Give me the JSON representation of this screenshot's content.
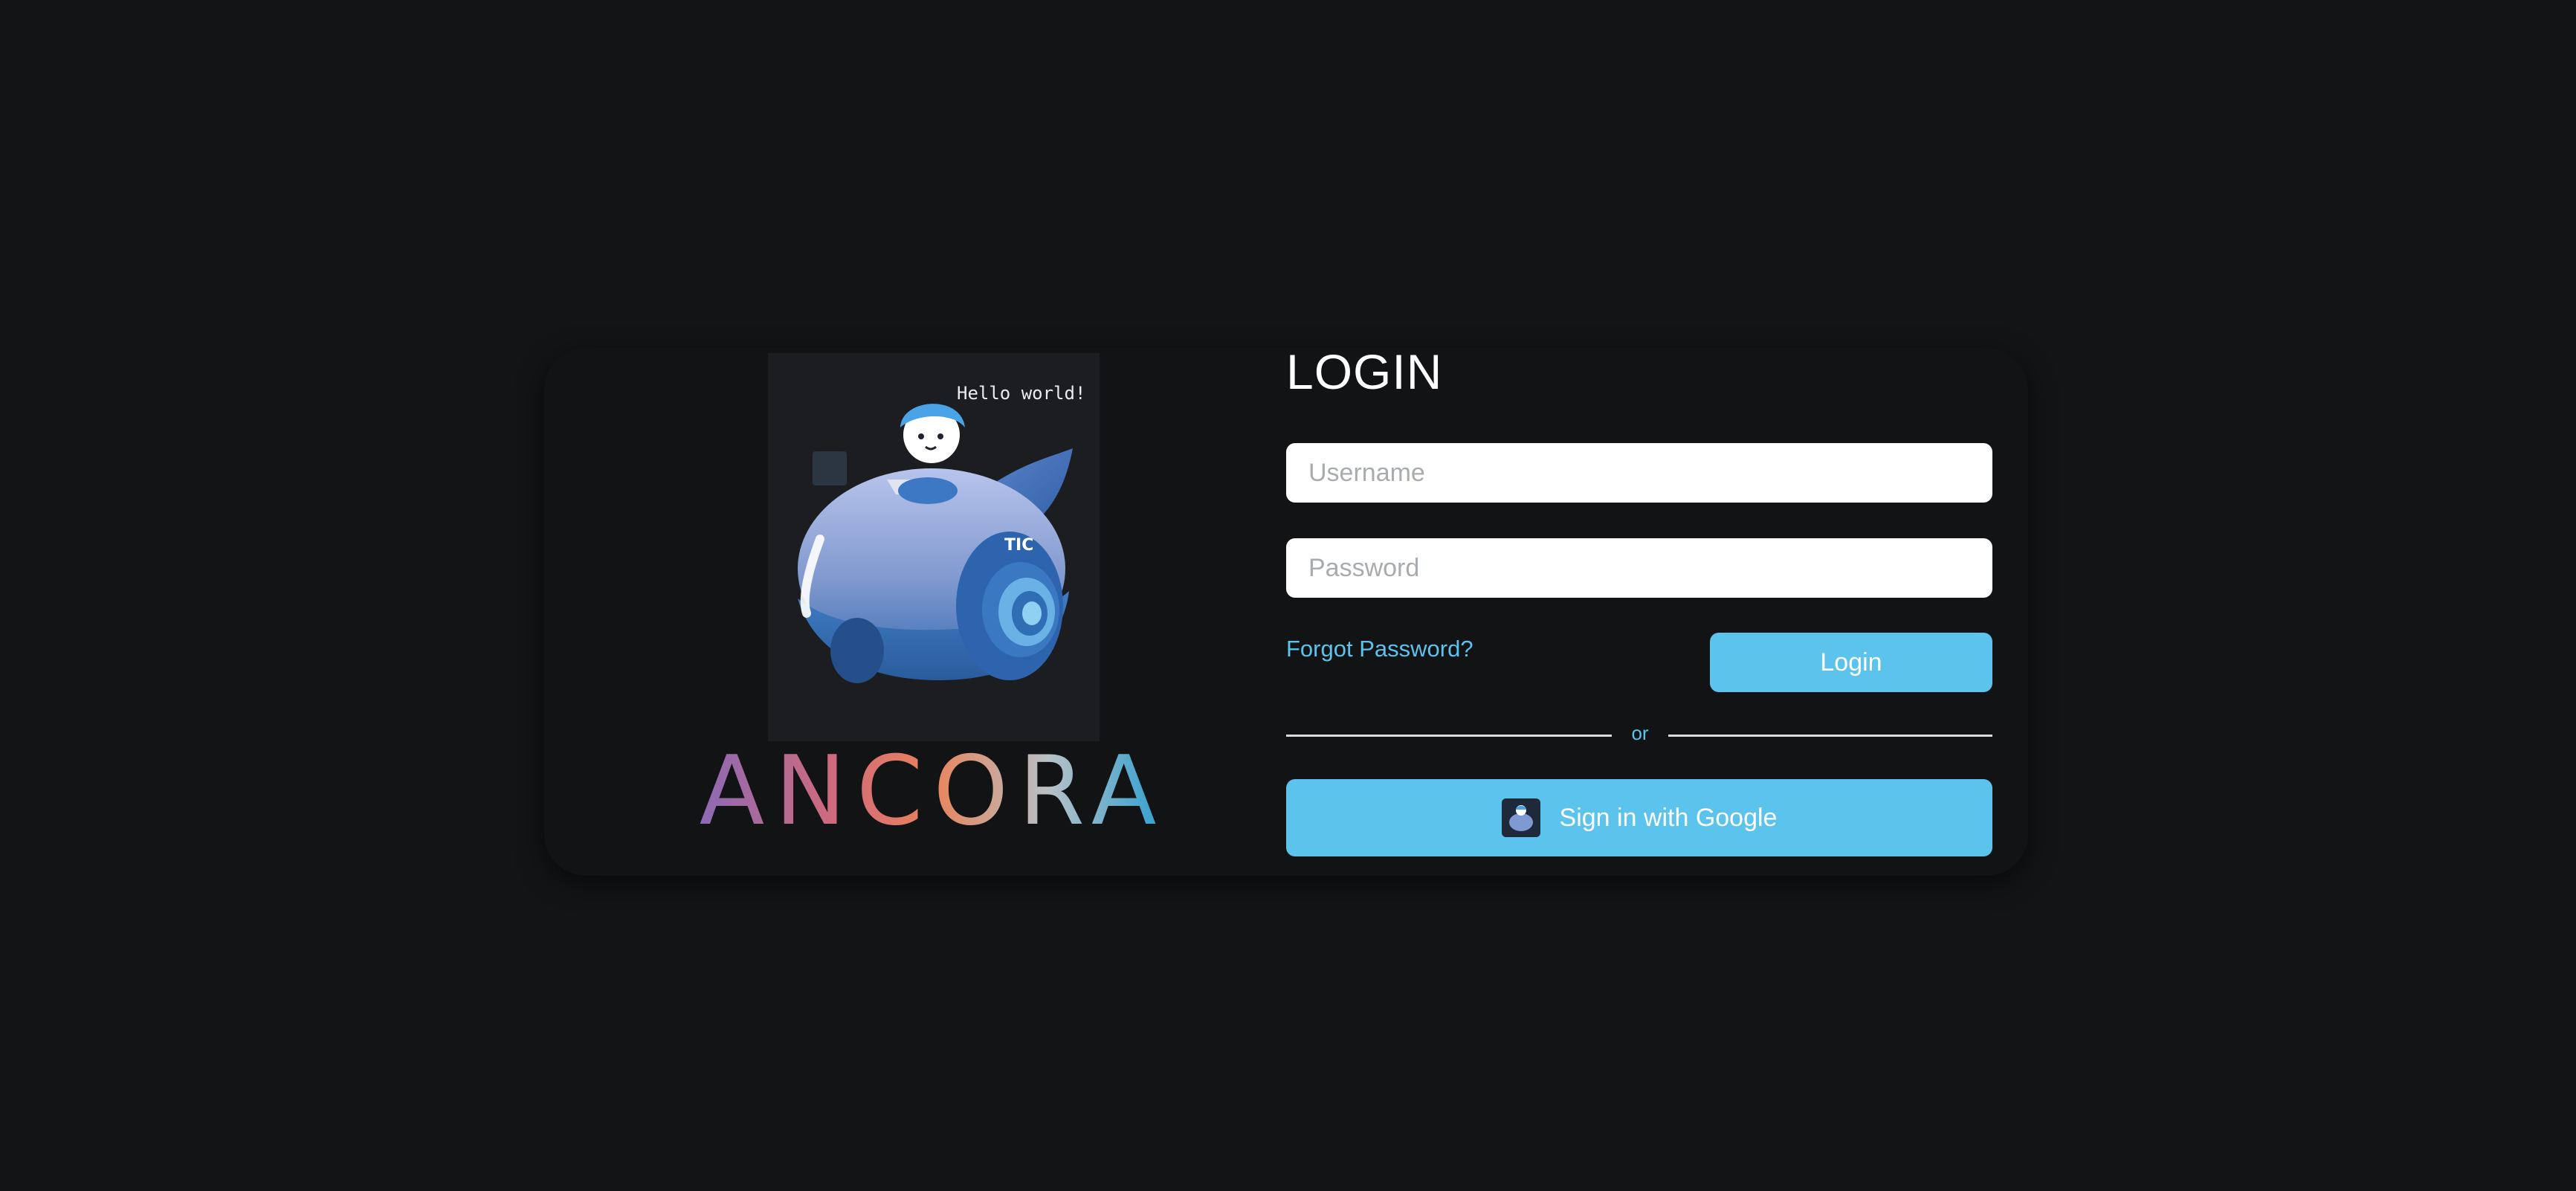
{
  "illustration": {
    "speech_text": "Hello world!",
    "icon": "robot-whale-mascot"
  },
  "brand": {
    "name": "ANCORA",
    "gradient": [
      "#8c69b5",
      "#d36a7a",
      "#e8845b",
      "#b6c1c7",
      "#2c9fd1"
    ]
  },
  "login": {
    "title": "LOGIN",
    "username_placeholder": "Username",
    "password_placeholder": "Password",
    "forgot_label": "Forgot Password?",
    "login_label": "Login",
    "divider_text": "or",
    "google_label": "Sign in with Google"
  },
  "colors": {
    "background": "#131416",
    "accent": "#5bc3ec",
    "input_bg": "#ffffff"
  }
}
